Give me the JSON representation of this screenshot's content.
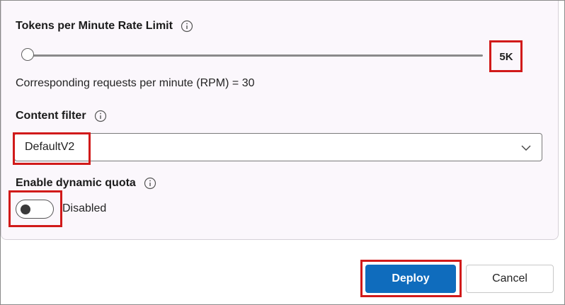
{
  "tokens": {
    "label": "Tokens per Minute Rate Limit",
    "value_label": "5K",
    "slider_level": 0.0
  },
  "rpm": {
    "text": "Corresponding requests per minute (RPM) = 30"
  },
  "content_filter": {
    "label": "Content filter",
    "selected": "DefaultV2"
  },
  "dynamic_quota": {
    "label": "Enable dynamic quota",
    "state_label": "Disabled",
    "enabled": false
  },
  "actions": {
    "deploy_label": "Deploy",
    "cancel_label": "Cancel"
  },
  "colors": {
    "primary": "#0f6cbd",
    "highlight": "#d11a1a",
    "panel_bg": "#fbf7fc"
  }
}
